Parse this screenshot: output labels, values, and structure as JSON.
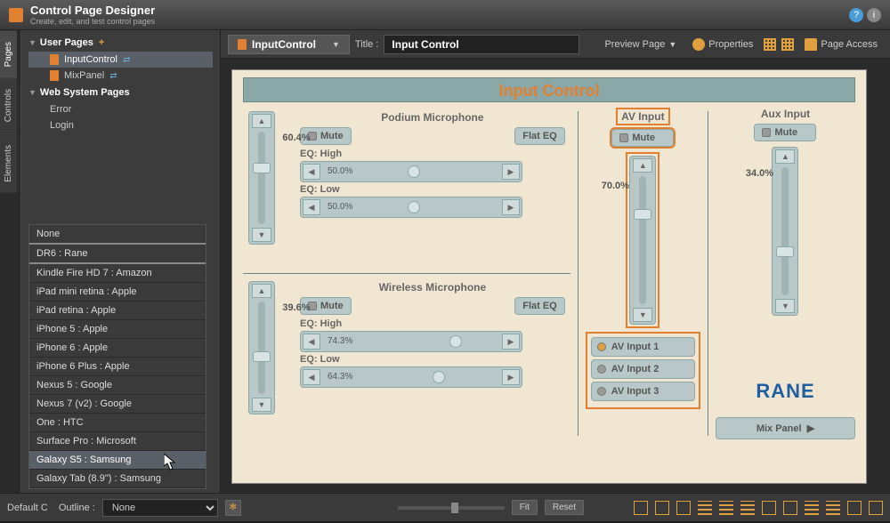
{
  "app": {
    "title": "Control Page Designer",
    "subtitle": "Create, edit, and test control pages"
  },
  "sideTabs": [
    "Pages",
    "Controls",
    "Elements"
  ],
  "tree": {
    "userPages": {
      "label": "User Pages",
      "items": [
        {
          "name": "InputControl",
          "selected": true
        },
        {
          "name": "MixPanel",
          "selected": false
        }
      ]
    },
    "sysPages": {
      "label": "Web System Pages",
      "items": [
        {
          "name": "Error"
        },
        {
          "name": "Login"
        }
      ]
    }
  },
  "deviceList": [
    "None",
    "DR6 : Rane",
    "Kindle Fire HD 7 : Amazon",
    "iPad mini retina : Apple",
    "iPad retina : Apple",
    "iPhone 5 : Apple",
    "iPhone 6 : Apple",
    "iPhone 6 Plus : Apple",
    "Nexus 5 : Google",
    "Nexus 7 (v2) : Google",
    "One : HTC",
    "Surface Pro : Microsoft",
    "Galaxy S5 : Samsung",
    "Galaxy Tab (8.9\") : Samsung"
  ],
  "toolbar": {
    "activeTab": "InputControl",
    "titleLabel": "Title :",
    "titleValue": "Input Control",
    "preview": "Preview Page",
    "properties": "Properties",
    "pageAccess": "Page Access"
  },
  "page": {
    "title": "Input Control",
    "podium": {
      "label": "Podium Microphone",
      "mute": "Mute",
      "flatEq": "Flat EQ",
      "eqHighLabel": "EQ: High",
      "eqHigh": "50.0%",
      "eqLowLabel": "EQ: Low",
      "eqLow": "50.0%",
      "level": "60.4%"
    },
    "wireless": {
      "label": "Wireless Microphone",
      "mute": "Mute",
      "flatEq": "Flat EQ",
      "eqHighLabel": "EQ: High",
      "eqHigh": "74.3%",
      "eqLowLabel": "EQ: Low",
      "eqLow": "64.3%",
      "level": "39.6%"
    },
    "avInput": {
      "label": "AV Input",
      "mute": "Mute",
      "level": "70.0%",
      "options": [
        "AV Input 1",
        "AV Input 2",
        "AV Input 3"
      ]
    },
    "auxInput": {
      "label": "Aux Input",
      "mute": "Mute",
      "level": "34.0%"
    },
    "logo": "RANE",
    "mixPanel": "Mix Panel"
  },
  "bottomBar": {
    "defaultLabel": "Default C",
    "outlineLabel": "Outline :",
    "outlineValue": "None",
    "fit": "Fit",
    "reset": "Reset"
  }
}
